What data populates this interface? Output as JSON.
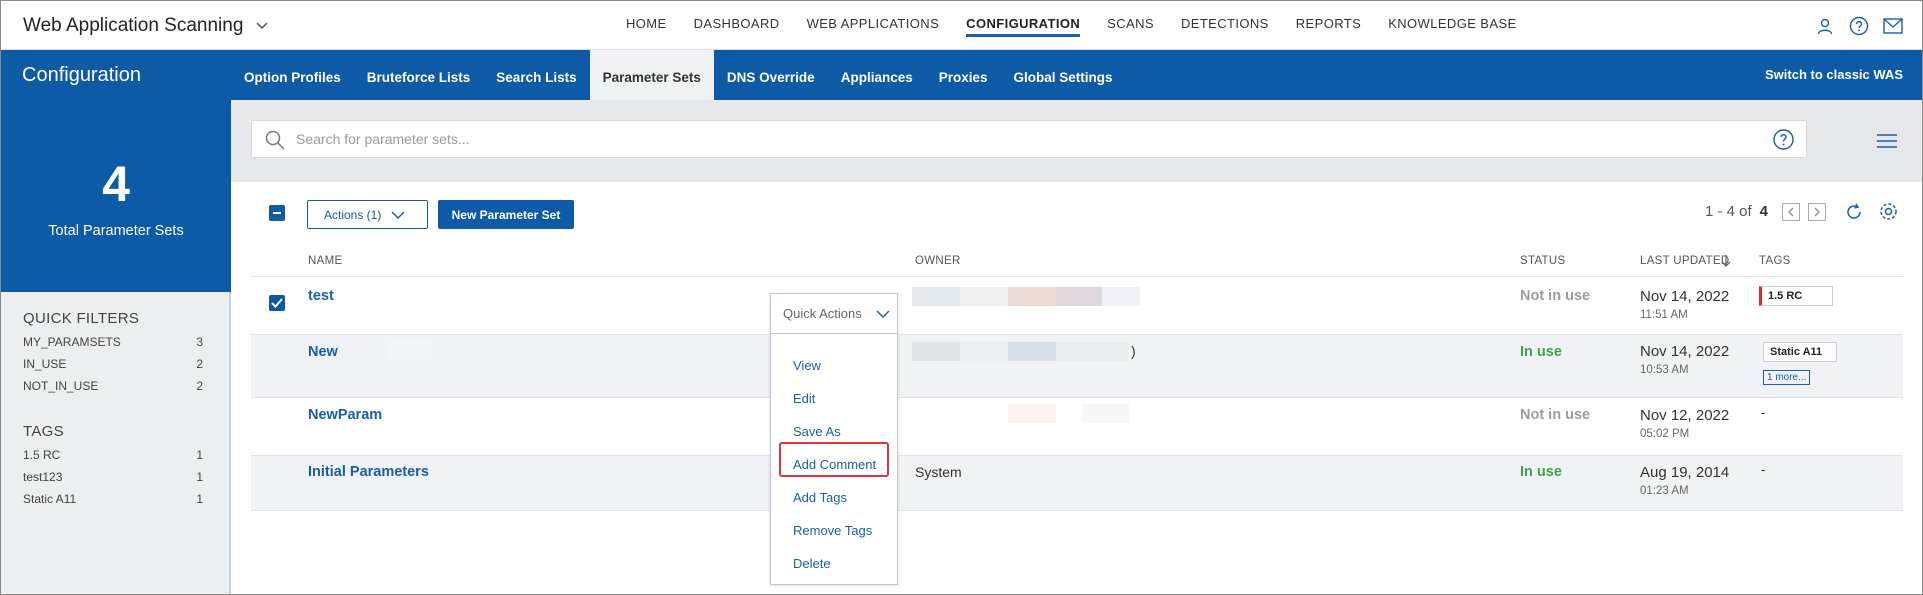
{
  "app": {
    "title": "Web Application Scanning"
  },
  "topnav": [
    {
      "label": "HOME",
      "active": false
    },
    {
      "label": "DASHBOARD",
      "active": false
    },
    {
      "label": "WEB APPLICATIONS",
      "active": false
    },
    {
      "label": "CONFIGURATION",
      "active": true
    },
    {
      "label": "SCANS",
      "active": false
    },
    {
      "label": "DETECTIONS",
      "active": false
    },
    {
      "label": "REPORTS",
      "active": false
    },
    {
      "label": "KNOWLEDGE BASE",
      "active": false
    }
  ],
  "top_icons": [
    "user-icon",
    "help-icon",
    "mail-icon"
  ],
  "config": {
    "title": "Configuration",
    "tabs": [
      {
        "label": "Option Profiles",
        "active": false
      },
      {
        "label": "Bruteforce Lists",
        "active": false
      },
      {
        "label": "Search Lists",
        "active": false
      },
      {
        "label": "Parameter Sets",
        "active": true
      },
      {
        "label": "DNS Override",
        "active": false
      },
      {
        "label": "Appliances",
        "active": false
      },
      {
        "label": "Proxies",
        "active": false
      },
      {
        "label": "Global Settings",
        "active": false
      }
    ],
    "switch_label": "Switch to classic WAS"
  },
  "summary": {
    "count": "4",
    "label": "Total Parameter Sets"
  },
  "quick_filters": {
    "title": "QUICK FILTERS",
    "items": [
      {
        "label": "MY_PARAMSETS",
        "count": "3"
      },
      {
        "label": "IN_USE",
        "count": "2"
      },
      {
        "label": "NOT_IN_USE",
        "count": "2"
      }
    ]
  },
  "tag_filters": {
    "title": "TAGS",
    "items": [
      {
        "label": "1.5 RC",
        "count": "1"
      },
      {
        "label": "test123",
        "count": "1"
      },
      {
        "label": "Static A11",
        "count": "1"
      }
    ]
  },
  "search": {
    "placeholder": "Search for parameter sets..."
  },
  "toolbar": {
    "actions_label": "Actions (1)",
    "new_label": "New Parameter Set",
    "pager_text": "1 - 4 of",
    "pager_total": "4"
  },
  "table": {
    "headers": {
      "name": "NAME",
      "owner": "OWNER",
      "status": "STATUS",
      "last_updated": "LAST UPDATED",
      "tags": "TAGS"
    },
    "rows": [
      {
        "name": "test",
        "owner": "",
        "status": "Not in use",
        "date": "Nov 14, 2022",
        "time": "11:51 AM",
        "tag": "1.5 RC",
        "more": "",
        "checked": true
      },
      {
        "name": "New",
        "owner": ")",
        "status": "In use",
        "date": "Nov 14, 2022",
        "time": "10:53 AM",
        "tag": "Static A11",
        "more": "1 more...",
        "checked": false
      },
      {
        "name": "NewParam",
        "owner": "",
        "status": "Not in use",
        "date": "Nov 12, 2022",
        "time": "05:02 PM",
        "tag": "-",
        "more": "",
        "checked": false
      },
      {
        "name": "Initial Parameters",
        "owner": "System",
        "status": "In use",
        "date": "Aug 19, 2014",
        "time": "01:23 AM",
        "tag": "-",
        "more": "",
        "checked": false
      }
    ]
  },
  "quick_actions": {
    "label": "Quick Actions",
    "items": [
      "View",
      "Edit",
      "Save As",
      "Add Comment",
      "Add Tags",
      "Remove Tags",
      "Delete"
    ],
    "highlighted": "Add Comment"
  },
  "colors": {
    "brand_blue": "#0d5aa7",
    "in_use": "#3fa34d",
    "not_in_use": "#9c9c9c",
    "highlight": "#d9363e"
  }
}
